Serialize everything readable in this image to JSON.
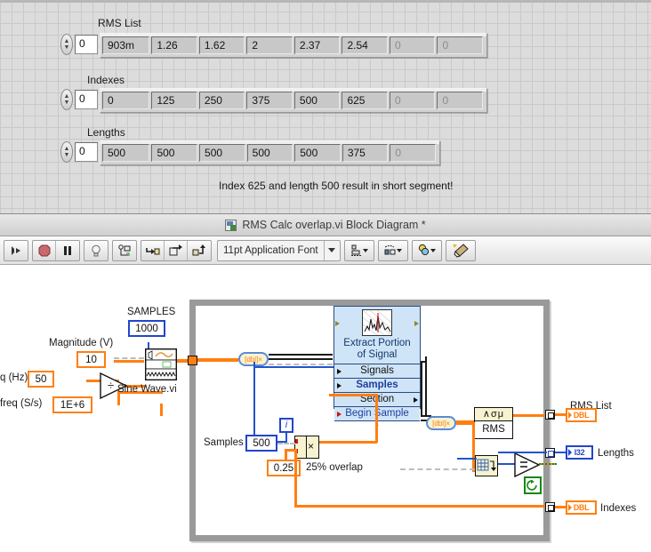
{
  "front_panel": {
    "controls": [
      {
        "label": "RMS List",
        "index_value": "0",
        "cells": [
          {
            "v": "903m",
            "dim": false
          },
          {
            "v": "1.26",
            "dim": false
          },
          {
            "v": "1.62",
            "dim": false
          },
          {
            "v": "2",
            "dim": false
          },
          {
            "v": "2.37",
            "dim": false
          },
          {
            "v": "2.54",
            "dim": false
          },
          {
            "v": "0",
            "dim": true
          },
          {
            "v": "0",
            "dim": true
          }
        ]
      },
      {
        "label": "Indexes",
        "index_value": "0",
        "cells": [
          {
            "v": "0",
            "dim": false
          },
          {
            "v": "125",
            "dim": false
          },
          {
            "v": "250",
            "dim": false
          },
          {
            "v": "375",
            "dim": false
          },
          {
            "v": "500",
            "dim": false
          },
          {
            "v": "625",
            "dim": false
          },
          {
            "v": "0",
            "dim": true
          },
          {
            "v": "0",
            "dim": true
          }
        ]
      },
      {
        "label": "Lengths",
        "index_value": "0",
        "cells": [
          {
            "v": "500",
            "dim": false
          },
          {
            "v": "500",
            "dim": false
          },
          {
            "v": "500",
            "dim": false
          },
          {
            "v": "500",
            "dim": false
          },
          {
            "v": "500",
            "dim": false
          },
          {
            "v": "375",
            "dim": false
          },
          {
            "v": "0",
            "dim": true
          }
        ]
      }
    ],
    "message": "Index 625 and length 500 result in short segment!"
  },
  "titlebar": {
    "title": "RMS Calc overlap.vi Block Diagram *",
    "icon": "vi-file-icon"
  },
  "toolbar": {
    "buttons": [
      {
        "name": "run-button",
        "glyph": "run-arrow-broken"
      },
      {
        "name": "abort-button",
        "glyph": "stop-octagon"
      },
      {
        "name": "pause-button",
        "glyph": "pause-bars"
      },
      {
        "name": "highlight-execution-button",
        "glyph": "light-bulb"
      },
      {
        "name": "retain-wire-values-button",
        "glyph": "probe-retain"
      },
      {
        "name": "step-into-button",
        "glyph": "step-into-arrow"
      },
      {
        "name": "step-over-button",
        "glyph": "step-over-arrow"
      },
      {
        "name": "step-out-button",
        "glyph": "step-out-arrow"
      }
    ],
    "font_selector": {
      "value": "11pt Application Font"
    },
    "menus": [
      {
        "name": "align-objects-menu",
        "glyph": "align-objects"
      },
      {
        "name": "distribute-objects-menu",
        "glyph": "distribute-objects"
      },
      {
        "name": "reorder-menu",
        "glyph": "reorder-objects"
      }
    ],
    "clean_up_button": {
      "name": "clean-up-diagram-button",
      "glyph": "broom"
    }
  },
  "diagram": {
    "labels": {
      "samples_const_label": "SAMPLES",
      "magnitude_label": "Magnitude (V)",
      "freq_label": "q (Hz)",
      "sample_freq_label": "freq (S/s)",
      "sine_wave_label": "Sine Wave.vi",
      "samples_label": "Samples",
      "overlap_label": "25% overlap",
      "rms_list_label": "RMS List",
      "lengths_label": "Lengths",
      "indexes_label": "Indexes",
      "rms_node_label": "RMS",
      "rms_node_glyph": "∧σμ"
    },
    "constants": {
      "samples_top": "1000",
      "magnitude": "10",
      "freq": "50",
      "sample_freq": "1E+6",
      "samples_loop": "500",
      "overlap_factor": "0.25",
      "iteration": "i"
    },
    "express_vi": {
      "title_line1": "Extract Portion",
      "title_line2": "of Signal",
      "rows": [
        "Signals",
        "Samples",
        "Section",
        "Begin Sample"
      ],
      "expand_glyph": "⌄"
    },
    "indicators": [
      {
        "name": "rms-list-indicator",
        "type": "DBL",
        "label": "RMS List"
      },
      {
        "name": "lengths-indicator",
        "type": "I32",
        "label": "Lengths"
      },
      {
        "name": "indexes-indicator",
        "type": "DBL",
        "label": "Indexes"
      }
    ],
    "nodes": {
      "divide_glyph": "÷",
      "multiply_glyph": "×",
      "equal_glyph": "=",
      "stop_glyph": "stop-loop-icon",
      "conv_glyph": "[dbl]×"
    }
  },
  "colors": {
    "wire_orange": "#ff7f11",
    "wire_blue": "#2245cc",
    "express_bg": "#cfe4f7",
    "loop_border": "#9a9a9a",
    "node_yellow": "#f7f2cf",
    "green": "#118811"
  }
}
